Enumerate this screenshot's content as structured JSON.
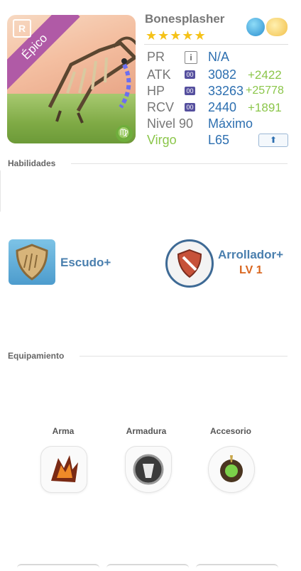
{
  "hero": {
    "name": "Bonesplasher",
    "rarity_label": "Épico",
    "rank_badge": "R",
    "zodiac_icon": "virgo-icon",
    "stars": "★★★★★",
    "elements": [
      "water-drop-icon",
      "cloud-icon"
    ]
  },
  "stats": {
    "pr": {
      "label": "PR",
      "value": "N/A"
    },
    "atk": {
      "label": "ATK",
      "badge": "00",
      "value": "3082",
      "bonus": "+2422"
    },
    "hp": {
      "label": "HP",
      "badge": "00",
      "value": "33263",
      "bonus": "+25778"
    },
    "rcv": {
      "label": "RCV",
      "badge": "00",
      "value": "2440",
      "bonus": "+1891"
    },
    "level": {
      "label": "Nivel 90",
      "value": "Máximo"
    },
    "sign": {
      "label": "Virgo",
      "value": "L65"
    }
  },
  "colors": {
    "accent": "#2d6fb0",
    "bonus": "#8bc64a",
    "epic": "#b05aa6",
    "level": "#d9661f"
  },
  "habilidades": {
    "title": "Habilidades",
    "skills": [
      {
        "name": "Escudo+",
        "icon": "shield-icon"
      },
      {
        "name": "Arrollador+",
        "level": "LV 1",
        "icon": "broken-shield-icon"
      }
    ]
  },
  "equipamiento": {
    "title": "Equipamiento",
    "slots": [
      {
        "label": "Arma",
        "icon": "lava-claw-icon"
      },
      {
        "label": "Armadura",
        "icon": "armor-orb-icon"
      },
      {
        "label": "Accesorio",
        "icon": "green-gem-icon"
      }
    ]
  }
}
